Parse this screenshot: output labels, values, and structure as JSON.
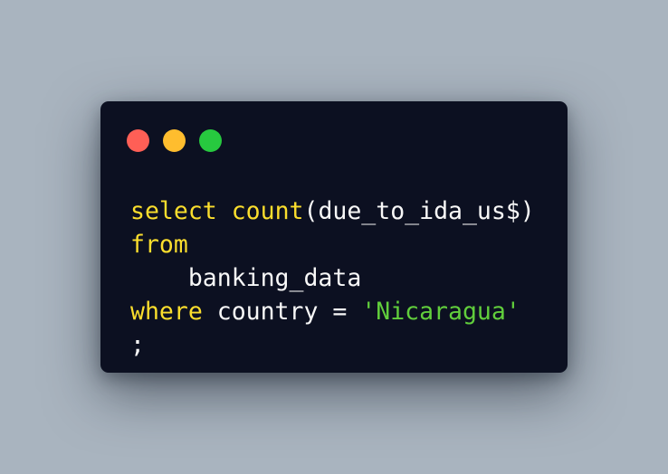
{
  "window": {
    "controls": [
      {
        "name": "close",
        "color": "#ff5f56"
      },
      {
        "name": "minimize",
        "color": "#ffbd2e"
      },
      {
        "name": "maximize",
        "color": "#27c93f"
      }
    ]
  },
  "code": {
    "line1": {
      "keyword": "select",
      "space": " ",
      "function": "count",
      "rest": "(due_to_ida_us$)"
    },
    "line2": {
      "keyword": "from"
    },
    "line3": {
      "indent": "    ",
      "table": "banking_data"
    },
    "line4": {
      "keyword": "where",
      "middle": " country = ",
      "string": "'Nicaragua'"
    },
    "line5": {
      "terminator": ";"
    }
  },
  "colors": {
    "background": "#a9b4bf",
    "editor_background": "#0c1021",
    "keyword": "#fbde2d",
    "string": "#61ce3c",
    "text": "#f8f8f8"
  }
}
